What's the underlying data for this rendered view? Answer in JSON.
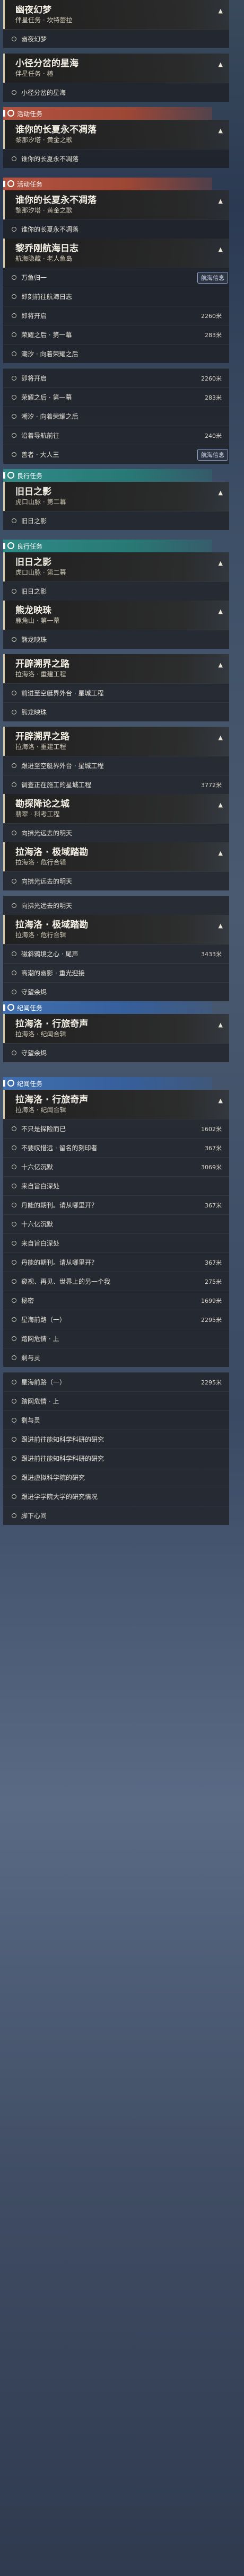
{
  "entries": [
    {
      "kind": "header",
      "title": "幽夜幻梦",
      "sub": "伴星任务 · 坎特蕾拉"
    },
    {
      "kind": "step",
      "text": "幽夜幻梦"
    },
    {
      "kind": "gap"
    },
    {
      "kind": "header",
      "title": "小径分岔的星海",
      "sub": "伴星任务 · 椿"
    },
    {
      "kind": "step",
      "text": "小径分岔的星海"
    },
    {
      "kind": "gap"
    },
    {
      "kind": "cat",
      "style": "activity",
      "text": "活动任务"
    },
    {
      "kind": "header",
      "title": "谁你的长夏永不凋落",
      "sub": "黎那汐塔 · 黄金之歌"
    },
    {
      "kind": "step",
      "text": "谁你的长夏永不凋落"
    },
    {
      "kind": "gap-l"
    },
    {
      "kind": "cat",
      "style": "activity",
      "text": "活动任务"
    },
    {
      "kind": "header",
      "title": "谁你的长夏永不凋落",
      "sub": "黎那汐塔 · 黄金之歌"
    },
    {
      "kind": "step",
      "text": "谁你的长夏永不凋落"
    },
    {
      "kind": "header",
      "title": "黎乔刚航海日志",
      "sub": "航海隐藏 · 老人鱼岛"
    },
    {
      "kind": "step",
      "text": "万鱼归一",
      "tag": "航海信息"
    },
    {
      "kind": "step",
      "text": "即刻前往航海日志"
    },
    {
      "kind": "step",
      "text": "即将开启",
      "dist": "2260米"
    },
    {
      "kind": "step",
      "text": "荣耀之后 · 第一幕",
      "dist": "283米"
    },
    {
      "kind": "step",
      "text": "潮汐 · 向着荣耀之后"
    },
    {
      "kind": "gap"
    },
    {
      "kind": "step",
      "text": "即将开启",
      "dist": "2260米"
    },
    {
      "kind": "step",
      "text": "荣耀之后 · 第一幕",
      "dist": "283米"
    },
    {
      "kind": "step",
      "text": "潮汐 · 向着荣耀之后"
    },
    {
      "kind": "step",
      "text": "沿着导航前往",
      "dist": "240米"
    },
    {
      "kind": "step",
      "text": "善者 · 大人王",
      "tag": "航海信息"
    },
    {
      "kind": "gap"
    },
    {
      "kind": "cat",
      "style": "rite",
      "text": "良行任务"
    },
    {
      "kind": "header",
      "title": "旧日之影",
      "sub": "虎口山脉 · 第二幕"
    },
    {
      "kind": "step",
      "text": "旧日之影"
    },
    {
      "kind": "gap-l"
    },
    {
      "kind": "cat",
      "style": "rite",
      "text": "良行任务"
    },
    {
      "kind": "header",
      "title": "旧日之影",
      "sub": "虎口山脉 · 第二幕"
    },
    {
      "kind": "step",
      "text": "旧日之影"
    },
    {
      "kind": "header",
      "title": "熊龙映珠",
      "sub": "鹿角山 · 第一幕"
    },
    {
      "kind": "step",
      "text": "熊龙映珠"
    },
    {
      "kind": "gap"
    },
    {
      "kind": "header",
      "title": "开辟溯界之路",
      "sub": "拉海洛 · 重建工程"
    },
    {
      "kind": "step",
      "text": "前进至空艇界外台 · 星城工程"
    },
    {
      "kind": "step",
      "text": "熊龙映珠"
    },
    {
      "kind": "gap"
    },
    {
      "kind": "header",
      "title": "开辟溯界之路",
      "sub": "拉海洛 · 重建工程"
    },
    {
      "kind": "step",
      "text": "跟进至空艇界外台 · 星城工程"
    },
    {
      "kind": "step",
      "text": "调查正在施工的星城工程",
      "dist": "3772米"
    },
    {
      "kind": "header",
      "title": "勘探降论之城",
      "sub": "翡翠 · 科考工程"
    },
    {
      "kind": "step",
      "text": "向拂光远去的明天"
    },
    {
      "kind": "header",
      "title": "拉海洛 · 极域踏勘",
      "sub": "拉海洛 · 危行合辑"
    },
    {
      "kind": "step",
      "text": "向拂光远去的明天"
    },
    {
      "kind": "gap"
    },
    {
      "kind": "step",
      "text": "向拂光远去的明天"
    },
    {
      "kind": "header",
      "title": "拉海洛 · 极域踏勘",
      "sub": "拉海洛 · 危行合辑"
    },
    {
      "kind": "step",
      "text": "磁斜鸦境之心 · 尾声",
      "dist": "3433米"
    },
    {
      "kind": "step",
      "text": "高潮的幽影 · 重光迎接"
    },
    {
      "kind": "step",
      "text": "守望余烬"
    },
    {
      "kind": "cat",
      "style": "legend",
      "text": "纪闻任务"
    },
    {
      "kind": "header",
      "title": "拉海洛 · 行旅奇声",
      "sub": "拉海洛 · 纪闻合辑"
    },
    {
      "kind": "step",
      "text": "守望余烬"
    },
    {
      "kind": "gap"
    },
    {
      "kind": "gap-l"
    },
    {
      "kind": "cat",
      "style": "legend",
      "text": "纪闻任务"
    },
    {
      "kind": "header",
      "title": "拉海洛 · 行旅奇声",
      "sub": "拉海洛 · 纪闻合辑"
    },
    {
      "kind": "step",
      "text": "不只是探险而已",
      "dist": "1602米"
    },
    {
      "kind": "step",
      "text": "不要叹惜远 · 留名的刻印者",
      "dist": "367米"
    },
    {
      "kind": "step",
      "text": "十六亿沉默",
      "dist": "3069米"
    },
    {
      "kind": "step",
      "text": "来自旨白深处"
    },
    {
      "kind": "step",
      "text": "丹能的期刊。请从哪里开？",
      "dist": "367米"
    },
    {
      "kind": "step",
      "text": "十六亿沉默"
    },
    {
      "kind": "step",
      "text": "来自旨白深处"
    },
    {
      "kind": "step",
      "text": "丹能的期刊。请从哪里开？",
      "dist": "367米"
    },
    {
      "kind": "step",
      "text": "窥视、再见、世界上的另一个我",
      "dist": "275米"
    },
    {
      "kind": "step",
      "text": "秘密",
      "dist": "1699米"
    },
    {
      "kind": "step",
      "text": "星海前路（一）",
      "dist": "2295米"
    },
    {
      "kind": "step",
      "text": "踏网危情 · 上"
    },
    {
      "kind": "step",
      "text": "剩与灵"
    },
    {
      "kind": "gap"
    },
    {
      "kind": "step",
      "text": "星海前路（一）",
      "dist": "2295米"
    },
    {
      "kind": "step",
      "text": "踏网危情 · 上"
    },
    {
      "kind": "step",
      "text": "剩与灵"
    },
    {
      "kind": "step",
      "text": "跟进前往能知科学科研的研究"
    },
    {
      "kind": "step",
      "text": "跟进前往能知科学科研的研究"
    },
    {
      "kind": "step",
      "text": "跟进虚拟科学院的研究"
    },
    {
      "kind": "step",
      "text": "跟进学学院大学的研究情况"
    },
    {
      "kind": "step",
      "text": "脚下心间"
    }
  ]
}
